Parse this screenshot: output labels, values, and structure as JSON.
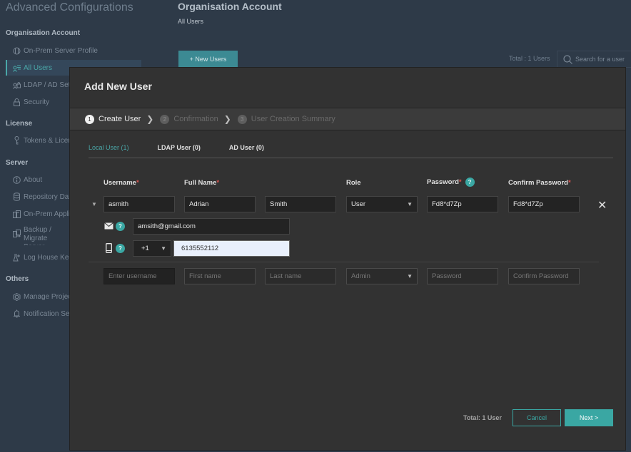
{
  "app": {
    "title": "Advanced Configurations"
  },
  "sidebar": {
    "sections": [
      {
        "heading": "Organisation Account",
        "items": [
          {
            "label": "On-Prem Server Profile",
            "icon": "server-profile-icon"
          },
          {
            "label": "All Users",
            "icon": "users-icon",
            "active": true
          },
          {
            "label": "LDAP / AD Settings",
            "icon": "ldap-icon"
          },
          {
            "label": "Security",
            "icon": "lock-icon"
          }
        ]
      },
      {
        "heading": "License",
        "items": [
          {
            "label": "Tokens & Licenses",
            "icon": "key-icon"
          }
        ]
      },
      {
        "heading": "Server",
        "items": [
          {
            "label": "About",
            "icon": "info-icon"
          },
          {
            "label": "Repository Database",
            "icon": "database-icon"
          },
          {
            "label": "On-Prem Application",
            "icon": "application-icon"
          },
          {
            "label": "Backup / Migrate Server",
            "icon": "backup-icon"
          },
          {
            "label": "Log House Keeping",
            "icon": "log-icon"
          }
        ]
      },
      {
        "heading": "Others",
        "items": [
          {
            "label": "Manage Projects",
            "icon": "projects-icon"
          },
          {
            "label": "Notification Settings",
            "icon": "bell-icon"
          }
        ]
      }
    ]
  },
  "main": {
    "title": "Organisation Account",
    "subtitle": "All Users",
    "new_users_label": "+ New Users",
    "total_users": "Total : 1 Users",
    "search_placeholder": "Search for a user"
  },
  "modal": {
    "title": "Add New User",
    "steps": [
      {
        "num": "1",
        "label": "Create User",
        "active": true
      },
      {
        "num": "2",
        "label": "Confirmation"
      },
      {
        "num": "3",
        "label": "User Creation Summary"
      }
    ],
    "tabs": [
      {
        "label": "Local User (1)",
        "active": true
      },
      {
        "label": "LDAP User (0)"
      },
      {
        "label": "AD User (0)"
      }
    ],
    "columns": {
      "username": "Username",
      "full_name": "Full Name",
      "role": "Role",
      "password": "Password",
      "confirm_password": "Confirm Password",
      "required_mark": "*",
      "help": "?"
    },
    "user_row": {
      "username": "asmith",
      "first_name": "Adrian",
      "last_name": "Smith",
      "role": "User",
      "password": "Fd8*d7Zp",
      "confirm_password": "Fd8*d7Zp",
      "email": "amsith@gmail.com",
      "country_code": "+1",
      "phone": "6135552112"
    },
    "new_row": {
      "username_placeholder": "Enter username",
      "first_name_placeholder": "First name",
      "last_name_placeholder": "Last name",
      "role": "Admin",
      "password_placeholder": "Password",
      "confirm_password_placeholder": "Confirm Password"
    },
    "footer": {
      "total": "Total: 1 User",
      "cancel_label": "Cancel",
      "next_label": "Next >"
    }
  },
  "colors": {
    "accent": "#3aa7a3",
    "sidebar_bg": "#2e3a48",
    "modal_bg": "#323232",
    "required": "#d9534f"
  }
}
